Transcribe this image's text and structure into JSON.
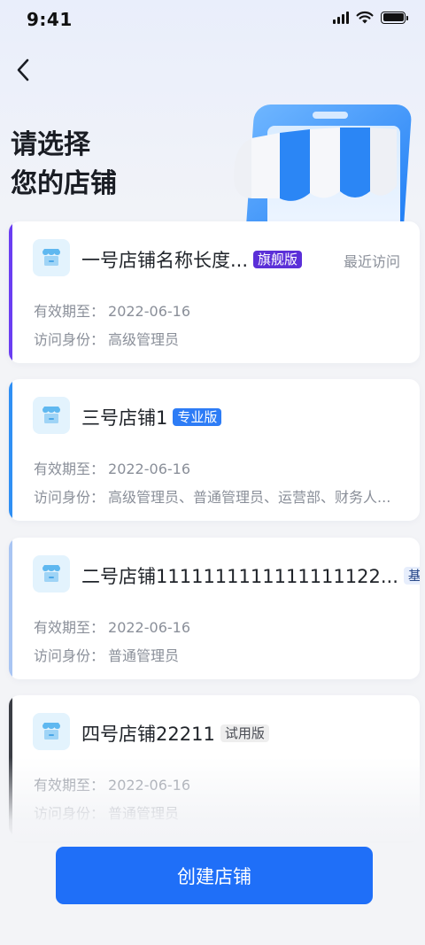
{
  "status_bar": {
    "time": "9:41",
    "icons": [
      "signal-icon",
      "wifi-icon",
      "battery-icon"
    ]
  },
  "header": {
    "back_icon": "chevron-left-icon",
    "title_line1": "请选择",
    "title_line2": "您的店铺",
    "illustration": "storefront-phone-illustration"
  },
  "stores": [
    {
      "name": "一号店铺名称长度...",
      "edition": "旗舰版",
      "recent_label": "最近访问",
      "expiry_label": "有效期至：",
      "expiry_value": "2022-06-16",
      "role_label": "访问身份：",
      "role_value": "高级管理员",
      "accent_color": "#6a3df2",
      "badge_bg": "#5b2fd8",
      "badge_fg": "#ffffff"
    },
    {
      "name": "三号店铺1",
      "edition": "专业版",
      "expiry_label": "有效期至：",
      "expiry_value": "2022-06-16",
      "role_label": "访问身份：",
      "role_value": "高级管理员、普通管理员、运营部、财务人...",
      "accent_color": "#2f8ff4",
      "badge_bg": "#2d7cf6",
      "badge_fg": "#ffffff"
    },
    {
      "name": "二号店铺1111111111111111122...",
      "edition": "基础版",
      "expiry_label": "有效期至：",
      "expiry_value": "2022-06-16",
      "role_label": "访问身份：",
      "role_value": "普通管理员",
      "accent_color": "#a9c5f3",
      "badge_bg": "#e7eefc",
      "badge_fg": "#2b4a8a"
    },
    {
      "name": "四号店铺22211",
      "edition": "试用版",
      "expiry_label": "有效期至：",
      "expiry_value": "2022-06-16",
      "role_label": "访问身份：",
      "role_value": "普通管理员",
      "accent_color": "#3a3d44",
      "badge_bg": "#eeeeee",
      "badge_fg": "#4a4d54"
    }
  ],
  "footer": {
    "create_label": "创建店铺"
  },
  "colors": {
    "primary": "#1f6ff8",
    "background": "#f3f4f7",
    "logo_bg": "#e3f3fd"
  }
}
